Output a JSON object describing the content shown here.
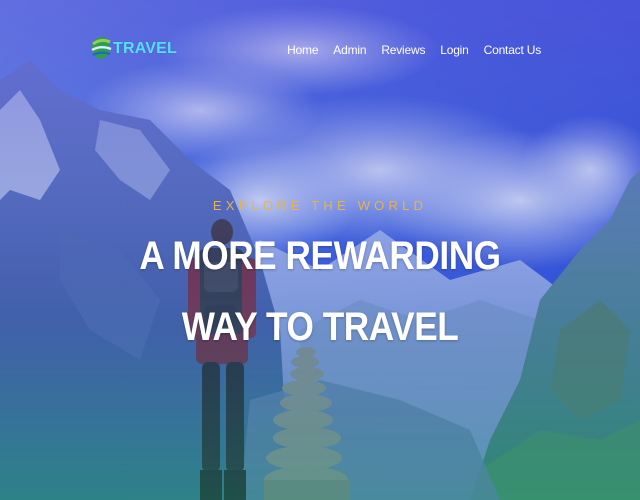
{
  "brand": {
    "name": "TRAVEL",
    "accent_color": "#56e0ff"
  },
  "nav": {
    "items": [
      {
        "label": "Home"
      },
      {
        "label": "Admin"
      },
      {
        "label": "Reviews"
      },
      {
        "label": "Login"
      },
      {
        "label": "Contact Us"
      }
    ]
  },
  "hero": {
    "tagline": "EXPLORE THE WORLD",
    "headline_line1": "A MORE REWARDING",
    "headline_line2": "WAY TO TRAVEL",
    "tagline_color": "#e8b24a",
    "background": "mountain-hiker-photo"
  }
}
